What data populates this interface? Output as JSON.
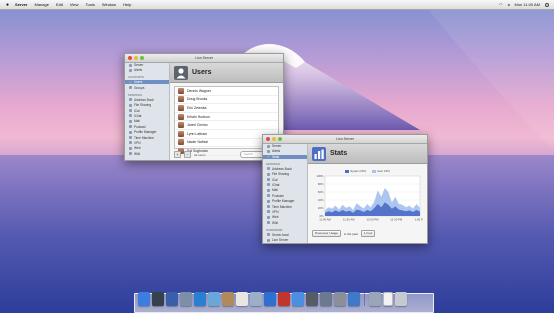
{
  "menubar": {
    "apple_icon": "apple-icon",
    "items": [
      "Server",
      "Manage",
      "Edit",
      "View",
      "Tools",
      "Window",
      "Help"
    ],
    "clock": "Mon 11:00 AM"
  },
  "users_window": {
    "title": "Lion Server",
    "heading": "Users",
    "sidebar": {
      "groups": [
        {
          "items": [
            "Server",
            "Alerts"
          ]
        },
        {
          "header": "Accounts",
          "items": [
            "Users",
            "Groups"
          ]
        },
        {
          "header": "Services",
          "items": [
            "Address Book",
            "File Sharing",
            "iCal",
            "iChat",
            "Mail",
            "Podcast",
            "Profile Manager",
            "Time Machine",
            "VPN",
            "Web",
            "Wiki"
          ]
        },
        {
          "header": "Hardware",
          "items": [
            "Server.local",
            "Lion Server"
          ]
        }
      ],
      "selected": "Users"
    },
    "users": [
      "Dennis Wagner",
      "Doug Brooks",
      "Eric Zelenka",
      "Kristin Hudson",
      "Jared Cimino",
      "Lynn Latham",
      "Nader Nafissi",
      "Sal Soghoian"
    ],
    "footer": {
      "add": "+",
      "remove": "−",
      "count": "All users",
      "search_placeholder": "Search"
    }
  },
  "stats_window": {
    "title": "Lion Server",
    "heading": "Stats",
    "sidebar": {
      "groups": [
        {
          "items": [
            "Server",
            "Alerts",
            "Stats"
          ]
        },
        {
          "header": "Services",
          "items": [
            "Address Book",
            "File Sharing",
            "iCal",
            "iChat",
            "Mail",
            "Podcast",
            "Profile Manager",
            "Time Machine",
            "VPN",
            "Web",
            "Wiki"
          ]
        },
        {
          "header": "Hardware",
          "items": [
            "Server.local",
            "Lion Server"
          ]
        }
      ],
      "selected": "Stats"
    },
    "legend": [
      {
        "name": "System CPU",
        "color": "#4f6fc7"
      },
      {
        "name": "User CPU",
        "color": "#a9c3ef"
      }
    ],
    "chart": {
      "type": "area",
      "yticks": [
        "100%",
        "80%",
        "60%",
        "40%",
        "20%",
        "0%"
      ],
      "xticks": [
        "11:00 AM",
        "11:30 AM",
        "12:00 PM",
        "12:30 PM",
        "1:00 PM"
      ],
      "series": [
        {
          "name": "User CPU",
          "values": [
            14,
            22,
            18,
            26,
            16,
            28,
            20,
            24,
            15,
            32,
            25,
            18,
            30,
            22,
            36,
            64,
            48,
            70,
            60,
            34,
            48,
            30,
            28,
            22,
            26,
            18,
            30,
            20
          ]
        },
        {
          "name": "System CPU",
          "values": [
            8,
            12,
            9,
            14,
            10,
            15,
            11,
            13,
            8,
            16,
            14,
            10,
            15,
            12,
            20,
            30,
            22,
            34,
            28,
            18,
            24,
            16,
            14,
            12,
            14,
            10,
            15,
            11
          ]
        }
      ]
    },
    "controls": {
      "metric": "Processor Usage",
      "period_label": "in the past",
      "period": "1 hour"
    }
  },
  "dock": {
    "apps": [
      {
        "name": "finder-icon",
        "color": "#3d7de0"
      },
      {
        "name": "dashboard-icon",
        "color": "#37404d"
      },
      {
        "name": "mission-control-icon",
        "color": "#3a5fa8"
      },
      {
        "name": "launchpad-icon",
        "color": "#7d8ea8"
      },
      {
        "name": "safari-icon",
        "color": "#2a7fd1"
      },
      {
        "name": "mail-icon",
        "color": "#6aa6d8"
      },
      {
        "name": "address-book-icon",
        "color": "#b08a5a"
      },
      {
        "name": "ical-icon",
        "color": "#e8e6e0"
      },
      {
        "name": "preview-icon",
        "color": "#9bb0c8"
      },
      {
        "name": "itunes-icon",
        "color": "#2e6fd0"
      },
      {
        "name": "photo-booth-icon",
        "color": "#c0352d"
      },
      {
        "name": "mac-app-store-icon",
        "color": "#4a8fe0"
      },
      {
        "name": "facetime-icon",
        "color": "#555c66"
      },
      {
        "name": "xcode-icon",
        "color": "#6c7a90"
      },
      {
        "name": "system-preferences-icon",
        "color": "#8a8f99"
      },
      {
        "name": "server-admin-icon",
        "color": "#3f7ac8"
      }
    ],
    "stacks": [
      {
        "name": "app-stack-icon",
        "color": "#9aa6b8"
      },
      {
        "name": "document-icon",
        "color": "#f2f2f2"
      },
      {
        "name": "trash-icon",
        "color": "#c5cad2"
      }
    ]
  }
}
